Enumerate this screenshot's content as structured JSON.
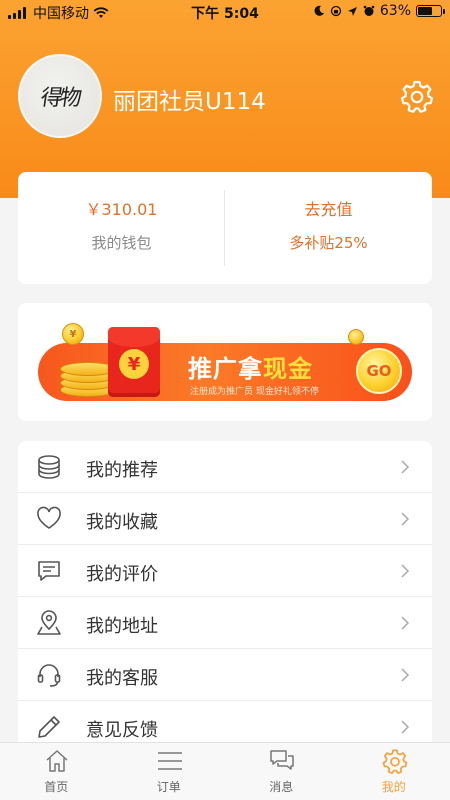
{
  "status_bar": {
    "carrier": "中国移动",
    "time": "下午 5:04",
    "battery": "63%",
    "battery_level": 0.63
  },
  "profile": {
    "username": "丽团社员U114",
    "settings_icon": "gear-icon"
  },
  "wallet": {
    "balance": "￥310.01",
    "balance_label": "我的钱包",
    "recharge_label": "去充值",
    "recharge_bonus": "多补贴25%"
  },
  "promo": {
    "title_main": "推广拿",
    "title_highlight": "现金",
    "subtitle": "注册成为推广员   现金好礼领不停",
    "go_label": "GO",
    "yen_symbol": "¥"
  },
  "menu": {
    "items": [
      {
        "label": "我的推荐",
        "icon": "coins-icon"
      },
      {
        "label": "我的收藏",
        "icon": "heart-icon"
      },
      {
        "label": "我的评价",
        "icon": "comment-icon"
      },
      {
        "label": "我的地址",
        "icon": "location-icon"
      },
      {
        "label": "我的客服",
        "icon": "headset-icon"
      },
      {
        "label": "意见反馈",
        "icon": "pencil-icon"
      }
    ]
  },
  "tabbar": {
    "tabs": [
      {
        "label": "首页",
        "icon": "home-icon",
        "active": false
      },
      {
        "label": "订单",
        "icon": "list-icon",
        "active": false
      },
      {
        "label": "消息",
        "icon": "message-icon",
        "active": false
      },
      {
        "label": "我的",
        "icon": "gear-icon",
        "active": true
      }
    ]
  },
  "colors": {
    "header_orange": "#f98a18",
    "accent_orange": "#e2712a",
    "tab_active": "#f7a03a"
  }
}
